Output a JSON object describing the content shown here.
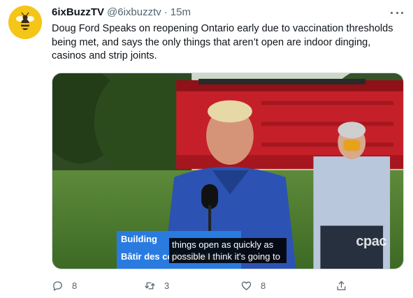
{
  "tweet": {
    "display_name": "6ixBuzzTV",
    "handle": "@6ixbuzztv",
    "separator": "·",
    "time": "15m",
    "text": "Doug Ford Speaks on reopening Ontario early due to vaccination thresholds being met, and says the only things that aren’t open are indoor dinging, casinos and strip joints."
  },
  "media": {
    "lower_third_top": "Building",
    "lower_third_bottom": "Bâtir des collectivités",
    "subtitle": "things open as quickly as possible I think it's going to",
    "watermark": "cpac",
    "lower_third_color": "#2a7be0"
  },
  "actions": {
    "reply_count": "8",
    "retweet_count": "3",
    "like_count": "8"
  },
  "icons": {
    "avatar": "bee-logo-icon",
    "more": "more-dots-icon",
    "reply": "reply-icon",
    "retweet": "retweet-icon",
    "like": "heart-icon",
    "share": "share-icon"
  },
  "colors": {
    "text": "#0f1419",
    "secondary": "#536471",
    "avatar_bg": "#f5c518"
  }
}
